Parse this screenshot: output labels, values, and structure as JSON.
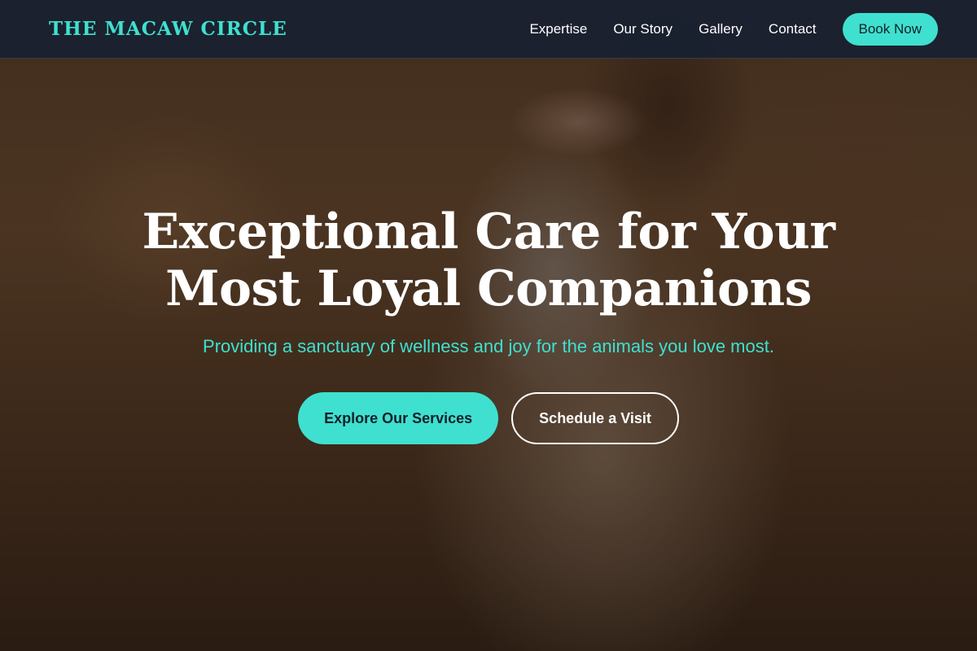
{
  "header": {
    "brand": "THE MACAW CIRCLE",
    "nav": [
      "Expertise",
      "Our Story",
      "Gallery",
      "Contact"
    ],
    "book_label": "Book Now"
  },
  "hero": {
    "title_line1": "Exceptional Care for Your",
    "title_line2": "Most Loyal Companions",
    "subtitle": "Providing a sanctuary of wellness and joy for the animals you love most.",
    "primary_cta": "Explore Our Services",
    "secondary_cta": "Schedule a Visit",
    "image": "woman-holding-white-rabbit-photo"
  },
  "colors": {
    "accent": "#3fe0cf",
    "nav_bg": "#182130",
    "text_light": "#ffffff",
    "button_text_dark": "#14202a"
  }
}
